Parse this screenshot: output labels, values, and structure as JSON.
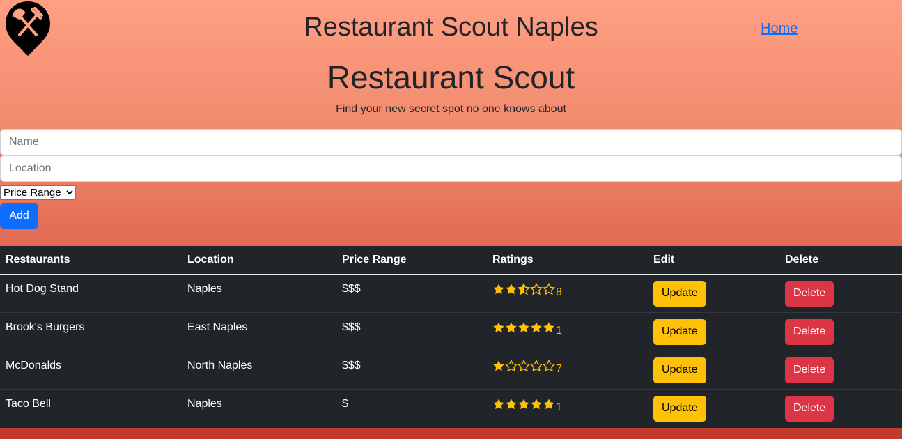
{
  "header": {
    "logo_icon": "restaurant-pin-icon",
    "title": "Restaurant Scout Naples",
    "home_link": "Home"
  },
  "hero": {
    "title": "Restaurant Scout",
    "subtitle": "Find your new secret spot no one knows about"
  },
  "form": {
    "name_placeholder": "Name",
    "location_placeholder": "Location",
    "price_select": "Price Range",
    "add_label": "Add"
  },
  "table": {
    "headers": [
      "Restaurants",
      "Location",
      "Price Range",
      "Ratings",
      "Edit",
      "Delete"
    ],
    "rows": [
      {
        "name": "Hot Dog Stand",
        "location": "Naples",
        "price": "$$$",
        "stars": 2.5,
        "count": "8",
        "update": "Update",
        "delete": "Delete"
      },
      {
        "name": "Brook's Burgers",
        "location": "East Naples",
        "price": "$$$",
        "stars": 5,
        "count": "1",
        "update": "Update",
        "delete": "Delete"
      },
      {
        "name": "McDonalds",
        "location": "North Naples",
        "price": "$$$",
        "stars": 1,
        "count": "7",
        "update": "Update",
        "delete": "Delete"
      },
      {
        "name": "Taco Bell",
        "location": "Naples",
        "price": "$",
        "stars": 5,
        "count": "1",
        "update": "Update",
        "delete": "Delete"
      }
    ]
  },
  "colors": {
    "star": "#ffc107",
    "primary": "#0d6efd",
    "warning": "#ffc107",
    "danger": "#dc3545",
    "table_bg": "#212529"
  }
}
